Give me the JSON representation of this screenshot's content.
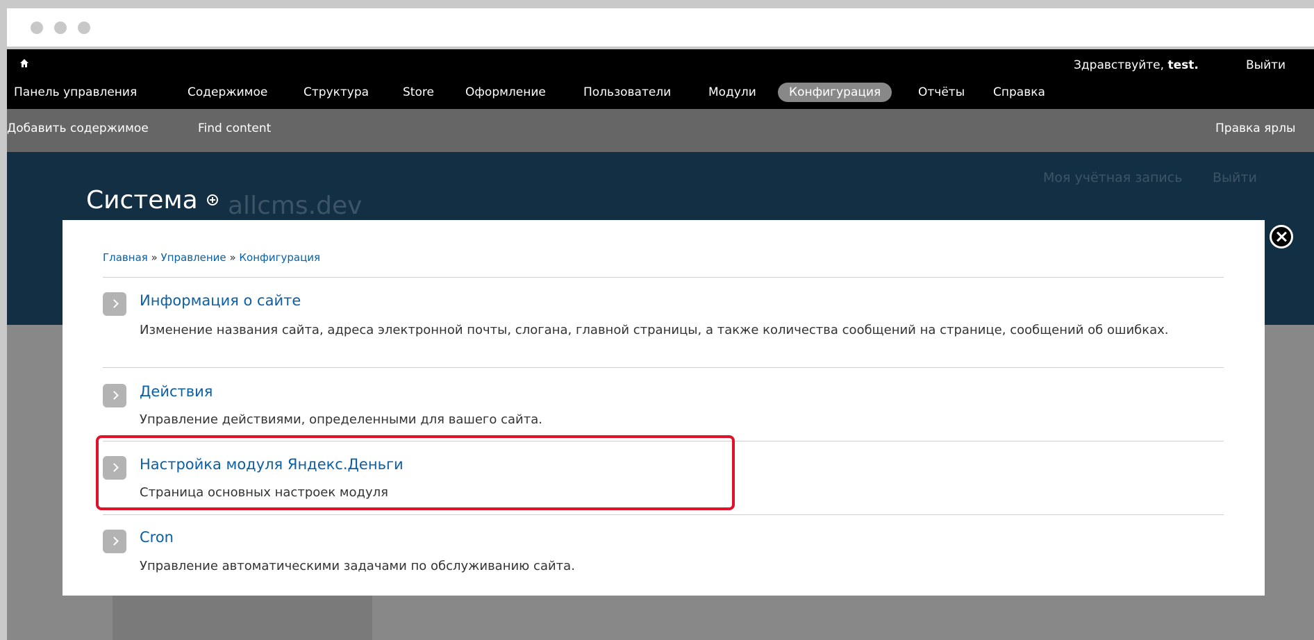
{
  "window": {
    "title_dots": [
      "close-dot",
      "minimize-dot",
      "maximize-dot"
    ]
  },
  "toolbar": {
    "home_icon": "home-icon",
    "greeting_prefix": "Здравствуйте, ",
    "greeting_user": "test.",
    "logout": "Выйти",
    "menu": [
      {
        "label": "Панель управления"
      },
      {
        "label": "Содержимое"
      },
      {
        "label": "Структура"
      },
      {
        "label": "Store"
      },
      {
        "label": "Оформление"
      },
      {
        "label": "Пользователи"
      },
      {
        "label": "Модули"
      },
      {
        "label": "Конфигурация",
        "active": true
      },
      {
        "label": "Отчёты"
      },
      {
        "label": "Справка"
      }
    ]
  },
  "shortcuts": {
    "add_content": "Добавить содержимое",
    "find_content": "Find content",
    "edit_shortcuts": "Правка ярлы"
  },
  "overlay": {
    "user_links": {
      "account": "Моя учётная запись",
      "logout": "Выйти"
    },
    "title": "Система",
    "watermark": "allcms.dev"
  },
  "dialog": {
    "breadcrumb": [
      "Главная",
      "Управление",
      "Конфигурация"
    ],
    "breadcrumb_separator": "»",
    "items": [
      {
        "title": "Информация о сайте",
        "description": "Изменение названия сайта, адреса электронной почты, слогана, главной страницы, а также количества сообщений на странице, сообщений об ошибках."
      },
      {
        "title": "Действия",
        "description": "Управление действиями, определенными для вашего сайта."
      },
      {
        "title": "Настройка модуля Яндекс.Деньги",
        "description": "Страница основных настроек модуля",
        "highlighted": true
      },
      {
        "title": "Cron",
        "description": "Управление автоматическими задачами по обслуживанию сайта."
      }
    ]
  },
  "colors": {
    "toolbar_bg": "#000000",
    "shortcuts_bg": "#666666",
    "overlay_header_bg": "#132f44",
    "link": "#0b5fa5",
    "highlight_border": "#e0122a",
    "active_tab_bg": "#888888"
  }
}
